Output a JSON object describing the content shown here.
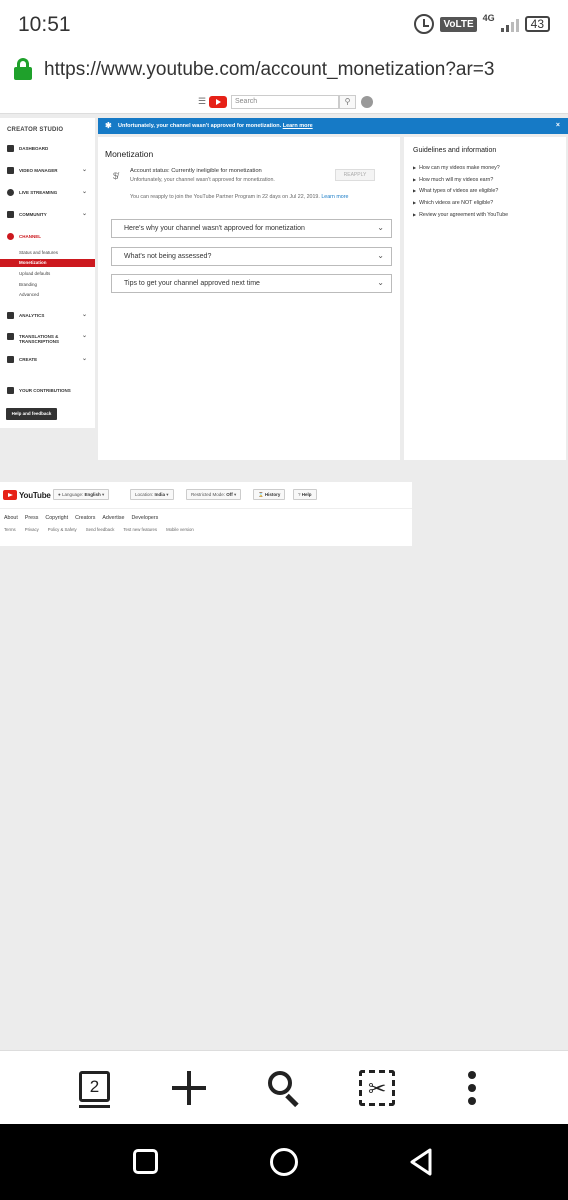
{
  "status_bar": {
    "time": "10:51",
    "volte": "VoLTE",
    "network": "4G",
    "battery": "43"
  },
  "browser": {
    "url": "https://www.youtube.com/account_monetization?ar=3",
    "tab_count": "2"
  },
  "yt_header": {
    "search_placeholder": "Search"
  },
  "sidebar": {
    "title": "CREATOR STUDIO",
    "items": [
      {
        "label": "DASHBOARD",
        "icon": "dashboard-icon"
      },
      {
        "label": "VIDEO MANAGER",
        "icon": "video-manager-icon"
      },
      {
        "label": "LIVE STREAMING",
        "icon": "live-streaming-icon"
      },
      {
        "label": "COMMUNITY",
        "icon": "community-icon"
      },
      {
        "label": "CHANNEL",
        "icon": "channel-icon"
      },
      {
        "label": "ANALYTICS",
        "icon": "analytics-icon"
      },
      {
        "label": "TRANSLATIONS & TRANSCRIPTIONS",
        "icon": "translate-icon"
      },
      {
        "label": "CREATE",
        "icon": "create-icon"
      },
      {
        "label": "YOUR CONTRIBUTIONS",
        "icon": "contributions-icon"
      }
    ],
    "channel_sub": [
      "Status and features",
      "Monetization",
      "Upload defaults",
      "Branding",
      "Advanced"
    ],
    "help_button": "Help and feedback",
    "active_color": "#cc181e"
  },
  "banner": {
    "message": "Unfortunately, your channel wasn't approved for monetization.",
    "link": "Learn more",
    "color": "#167ac6"
  },
  "monetization": {
    "title": "Monetization",
    "status": "Account status: Currently ineligible for monetization",
    "status_sub": "Unfortunately, your channel wasn't approved for monetization.",
    "reapply_button": "REAPPLY",
    "reapply_note": "You can reapply to join the YouTube Partner Program in 22 days on Jul 22, 2019.",
    "reapply_link": "Learn more",
    "accordions": [
      "Here's why your channel wasn't approved for monetization",
      "What's not being assessed?",
      "Tips to get your channel approved next time"
    ]
  },
  "guidelines": {
    "title": "Guidelines and information",
    "links": [
      "How can my videos make money?",
      "How much will my videos earn?",
      "What types of videos are eligible?",
      "Which videos are NOT eligible?",
      "Review your agreement with YouTube"
    ]
  },
  "footer": {
    "logo_text": "YouTube",
    "language_label": "Language:",
    "language_value": "English",
    "location_label": "Location:",
    "location_value": "India",
    "restricted_label": "Restricted Mode:",
    "restricted_value": "Off",
    "history": "History",
    "help": "Help",
    "links_primary": [
      "About",
      "Press",
      "Copyright",
      "Creators",
      "Advertise",
      "Developers"
    ],
    "links_secondary": [
      "Terms",
      "Privacy",
      "Policy & Safety",
      "Send feedback",
      "Test new features",
      "Mobile version"
    ]
  }
}
